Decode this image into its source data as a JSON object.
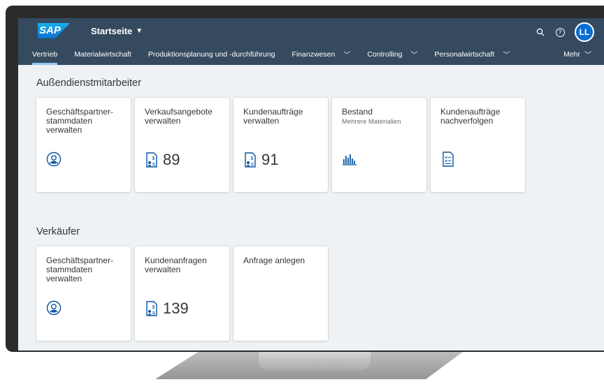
{
  "shell": {
    "logo": "SAP",
    "title": "Startseite",
    "user_initials": "LL"
  },
  "tabs": [
    {
      "label": "Vertrieb",
      "active": true
    },
    {
      "label": "Materialwirtschaft"
    },
    {
      "label": "Produktionsplanung und -durchführung"
    },
    {
      "label": "Finanzwesen"
    },
    {
      "label": "Controlling"
    },
    {
      "label": "Personalwirtschaft"
    }
  ],
  "more_label": "Mehr",
  "sections": [
    {
      "title": "Außendienstmitarbeiter",
      "tiles": [
        {
          "title": "Geschäftspartner-stammdaten verwalten",
          "icon": "person-icon"
        },
        {
          "title": "Verkaufsangebote verwalten",
          "icon": "document-money-icon",
          "kpi": "89"
        },
        {
          "title": "Kundenaufträge verwalten",
          "icon": "document-money-icon",
          "kpi": "91"
        },
        {
          "title": "Bestand",
          "subtitle": "Mehrere Materialien",
          "icon": "bar-chart-icon"
        },
        {
          "title": "Kundenaufträge nachverfolgen",
          "icon": "checklist-document-icon"
        }
      ]
    },
    {
      "title": "Verkäufer",
      "tiles": [
        {
          "title": "Geschäftspartner-stammdaten verwalten",
          "icon": "person-icon"
        },
        {
          "title": "Kundenanfragen verwalten",
          "icon": "document-money-icon",
          "kpi": "139"
        },
        {
          "title": "Anfrage anlegen"
        }
      ]
    }
  ],
  "colors": {
    "shell": "#354a5f",
    "accent": "#0a6ed1",
    "icon": "#0854a0",
    "background": "#eff2f4"
  }
}
